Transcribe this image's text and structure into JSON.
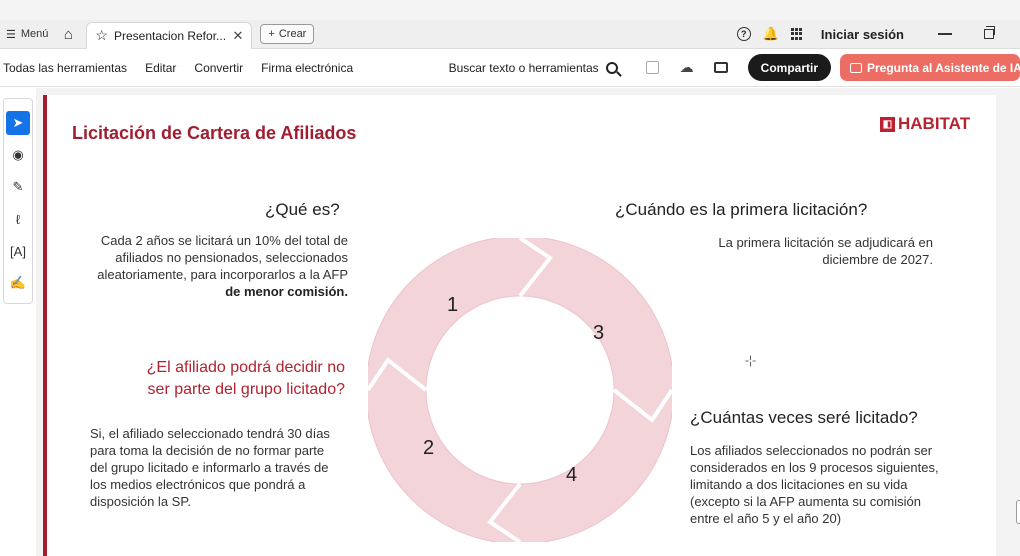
{
  "window": {
    "menu_label": "Menú",
    "tab_title": "Presentacion Refor...",
    "create_label": "Crear",
    "signin_label": "Iniciar sesión"
  },
  "toolbar": {
    "items": [
      "Todas las herramientas",
      "Editar",
      "Convertir",
      "Firma electrónica"
    ],
    "search_label": "Buscar texto o herramientas",
    "share_label": "Compartir",
    "assistant_label": "Pregunta al Asistente de IA"
  },
  "sidebar": {
    "tools": [
      "select-icon",
      "comment-icon",
      "pen-icon",
      "draw-icon",
      "text-select-icon",
      "sign-icon"
    ]
  },
  "slide": {
    "title": "Licitación de Cartera de Afiliados",
    "logo": {
      "mark": "AFP",
      "text": "HABITAT"
    },
    "sections": {
      "que_es": {
        "heading": "¿Qué es?",
        "body_lines": [
          "Cada 2 años se licitará un 10% del total de",
          "afiliados no pensionados, seleccionados",
          "aleatoriamente, para incorporarlos a la AFP"
        ],
        "body_bold": "de menor comisión."
      },
      "decidir": {
        "heading_lines": [
          "¿El afiliado podrá decidir no",
          "ser parte del grupo licitado?"
        ],
        "body_lines": [
          "Si, el afiliado seleccionado tendrá 30 días",
          "para toma la decisión de no formar parte",
          "del grupo licitado e informarlo a través de",
          "los medios electrónicos que pondrá a",
          "disposición la SP."
        ]
      },
      "cuando": {
        "heading": "¿Cuándo es la primera licitación?",
        "body_lines": [
          "La primera licitación se adjudicará en",
          "diciembre de 2027."
        ]
      },
      "cuantas": {
        "heading": "¿Cuántas veces seré licitado?",
        "body_lines": [
          "Los afiliados seleccionados no podrán ser",
          "considerados en los 9 procesos siguientes,",
          "limitando a dos licitaciones en su vida",
          "(excepto si la AFP aumenta su comisión",
          "entre el año 5 y el año 20)"
        ]
      }
    },
    "cycle_numbers": [
      "1",
      "3",
      "2",
      "4"
    ],
    "colors": {
      "accent": "#a11d2f",
      "ring": "#f2d4d9",
      "ring_stroke": "#e8aeb8"
    }
  }
}
